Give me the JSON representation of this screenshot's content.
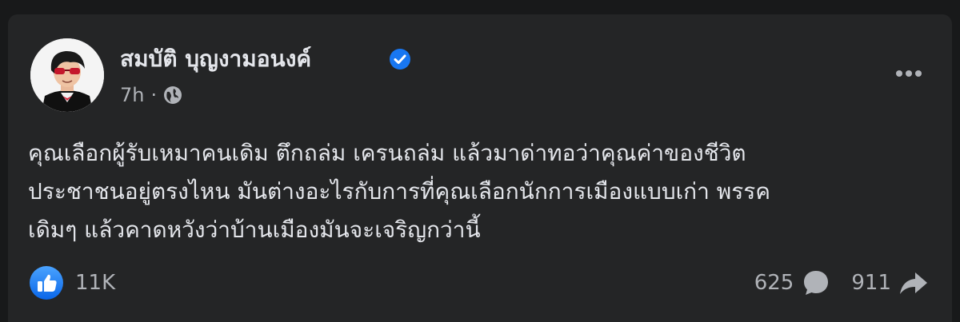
{
  "post": {
    "author": "สมบัติ บุญงามอนงค์",
    "time": "7h",
    "separator": "·",
    "text_lines": [
      "คุณเลือกผู้รับเหมาคนเดิม ตึกถล่ม เครนถล่ม แล้วมาด่าทอว่าคุณค่าของชีวิต",
      "ประชาชนอยู่ตรงไหน  มันต่างอะไรกับการที่คุณเลือกนักการเมืองแบบเก่า พรรค",
      "เดิมๆ แล้วคาดหวังว่าบ้านเมืองมันจะเจริญกว่านี้"
    ],
    "reactions_count": "11K",
    "comments_count": "625",
    "shares_count": "911"
  },
  "icons": {
    "verified": "verified-badge-icon",
    "privacy": "globe-icon",
    "more": "more-options-icon",
    "like": "like-icon",
    "comment": "comment-icon",
    "share": "share-icon"
  },
  "colors": {
    "background": "#18191a",
    "card": "#242526",
    "primary_text": "#e4e6eb",
    "secondary_text": "#b0b3b8",
    "accent_blue": "#1877f2"
  }
}
